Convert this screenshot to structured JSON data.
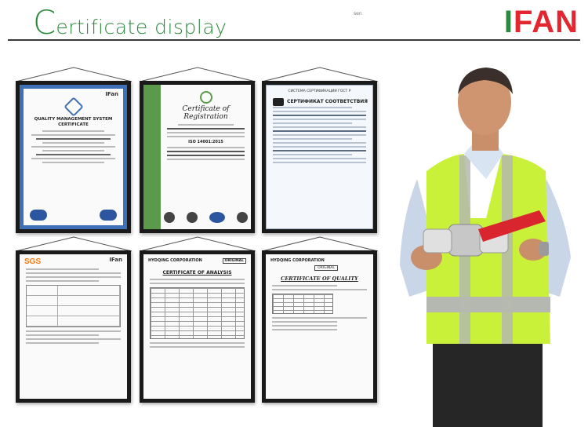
{
  "header": {
    "title_initial": "C",
    "title_rest": "ertificate display",
    "tiny_mark": "sen"
  },
  "brand": {
    "logo_part1": "I",
    "logo_part2": "FAN"
  },
  "certificates": [
    {
      "logo": "IFan",
      "title": "QUALITY MANAGEMENT SYSTEM CERTIFICATE"
    },
    {
      "title": "Certificate of Registration",
      "standard": "ISO 14001:2015"
    },
    {
      "title": "СЕРТИФИКАТ СООТВЕТСТВИЯ",
      "header": "СИСТЕМА СЕРТИФИКАЦИИ ГОСТ Р"
    },
    {
      "mark": "SGS",
      "logo": "IFan"
    },
    {
      "company": "HYDQING CORPORATION",
      "stamp": "ORIGINAL",
      "title": "CERTIFICATE OF ANALYSIS"
    },
    {
      "company": "HYDQING CORPORATION",
      "stamp": "ORIGINAL",
      "title": "CERTIFICATE OF QUALITY"
    }
  ],
  "colors": {
    "brand_green": "#2c8a3e",
    "brand_red": "#e3262f",
    "vest": "#c9f13a"
  }
}
